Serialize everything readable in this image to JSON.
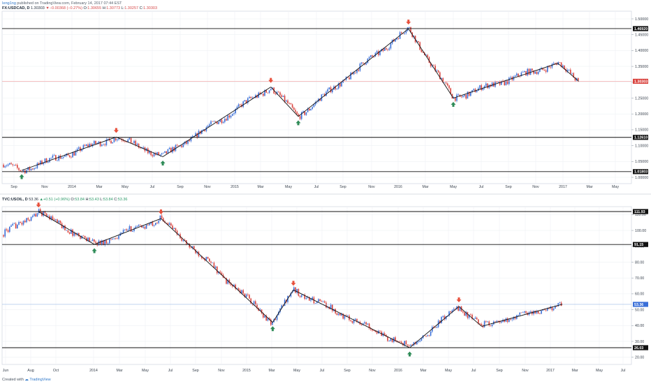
{
  "header": {
    "user": "Ieng1ng",
    "published_text": "published on TradingView.com, February 14, 2017 07:44 EST"
  },
  "footer": {
    "created_with": "Created with",
    "brand": "TradingView"
  },
  "colors": {
    "candle_up": "#3a6fd8",
    "candle_down": "#d9433e",
    "arrow_down": "#e8503c",
    "arrow_up": "#2e8b57",
    "last_price_line_top": "#f19b9b",
    "last_price_line_bottom": "#9bb9e8",
    "trendline": "#111111"
  },
  "chart_data": [
    {
      "type": "candlestick",
      "symbol_label": "FX:USDCAD, D",
      "close_value": "1.30303",
      "change_value": "▼−0.00368 (−0.27%)",
      "ohlc": {
        "o": "1.30655",
        "h": "1.30773",
        "l": "1.30257",
        "c": "1.30303"
      },
      "ylim": [
        1.0,
        1.5
      ],
      "y_ticks": [
        "1.50000",
        "1.45000",
        "1.40000",
        "1.35000",
        "1.30000",
        "1.25000",
        "1.20000",
        "1.15000",
        "1.10000",
        "1.05000",
        "1.00000"
      ],
      "x_ticks": [
        "Sep",
        "Nov",
        "2014",
        "Mar",
        "May",
        "Jul",
        "Sep",
        "Nov",
        "2015",
        "Mar",
        "May",
        "Jul",
        "Sep",
        "Nov",
        "2016",
        "Mar",
        "May",
        "Jul",
        "Sep",
        "Nov",
        "2017",
        "Mar",
        "May"
      ],
      "horizontal_levels": [
        "1.46920",
        "1.12610",
        "1.01803"
      ],
      "last_price": "1.30303",
      "swing_path": [
        [
          "2013-08-15",
          1.022
        ],
        [
          "2014-03-20",
          1.127
        ],
        [
          "2014-07-05",
          1.065
        ],
        [
          "2015-03-10",
          1.285
        ],
        [
          "2015-05-12",
          1.192
        ],
        [
          "2016-01-20",
          1.469
        ],
        [
          "2016-05-02",
          1.25
        ],
        [
          "2016-12-28",
          1.36
        ],
        [
          "2017-02-14",
          1.303
        ]
      ],
      "down_arrows": [
        [
          "2014-03-20",
          1.127
        ],
        [
          "2015-03-10",
          1.285
        ],
        [
          "2016-01-20",
          1.469
        ]
      ],
      "up_arrows": [
        [
          "2013-08-15",
          1.022
        ],
        [
          "2014-07-05",
          1.065
        ],
        [
          "2015-05-12",
          1.192
        ],
        [
          "2016-05-02",
          1.25
        ]
      ]
    },
    {
      "type": "candlestick",
      "symbol_label": "TVC:USOIL, D",
      "close_value": "53.36",
      "change_value": "▲+0.51 (+0.96%)",
      "ohlc": {
        "o": "53.84",
        "h": "53.43",
        "l": "53.84",
        "c": "53.36"
      },
      "ylim": [
        20,
        112
      ],
      "y_ticks": [
        "110.00",
        "100.00",
        "90.00",
        "80.00",
        "70.00",
        "60.00",
        "50.00",
        "40.00",
        "30.00",
        "20.00"
      ],
      "x_ticks": [
        "Jun",
        "Aug",
        "Oct",
        "2014",
        "Mar",
        "May",
        "Jul",
        "Sep",
        "Nov",
        "2015",
        "Mar",
        "May",
        "Jul",
        "Sep",
        "Nov",
        "2016",
        "Mar",
        "May",
        "Jul",
        "Sep",
        "Nov",
        "2017",
        "Mar",
        "May",
        "Jul"
      ],
      "horizontal_levels": [
        "111.93",
        "91.15",
        "26.03"
      ],
      "last_price": "53.36",
      "swing_path": [
        [
          "2013-08-28",
          111.9
        ],
        [
          "2014-01-10",
          91.2
        ],
        [
          "2014-06-20",
          107.5
        ],
        [
          "2015-03-17",
          42.0
        ],
        [
          "2015-05-06",
          62.5
        ],
        [
          "2016-02-11",
          26.0
        ],
        [
          "2016-06-09",
          52.0
        ],
        [
          "2016-08-03",
          39.5
        ],
        [
          "2017-02-14",
          53.4
        ]
      ],
      "down_arrows": [
        [
          "2013-08-28",
          111.9
        ],
        [
          "2014-06-20",
          107.5
        ],
        [
          "2015-05-06",
          62.5
        ],
        [
          "2016-06-09",
          52.0
        ]
      ],
      "up_arrows": [
        [
          "2014-01-10",
          91.2
        ],
        [
          "2015-03-17",
          42.0
        ],
        [
          "2016-02-11",
          26.0
        ]
      ]
    }
  ]
}
